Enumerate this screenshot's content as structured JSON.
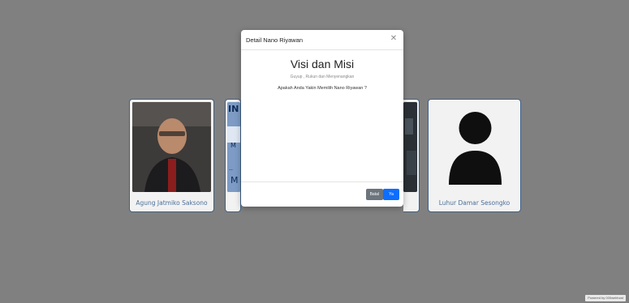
{
  "cards": [
    {
      "name": "Agung Jatmiko Saksono",
      "photo": "portrait-photo"
    },
    {
      "name": "",
      "photo": "poster-photo"
    },
    {
      "name": "",
      "photo": "event-photo"
    },
    {
      "name": "Luhur Damar Sesongko",
      "photo": "default-avatar-silhouette"
    }
  ],
  "modal": {
    "title": "Detail Nano Riyawan",
    "heading": "Visi dan Misi",
    "subtitle": "Guyup , Rukun dan Menyenangkan",
    "question": "Apakah Anda Yakin Memilih Nano Riyawan ?",
    "cancel_label": "Batal",
    "yes_label": "Ya",
    "close_icon": "close-icon"
  },
  "footer": {
    "powered_by": "Powered by 000webhost"
  },
  "colors": {
    "backdrop": "#808080",
    "card_border": "#3e5f86",
    "name_text": "#4b6f99",
    "btn_secondary": "#6c757d",
    "btn_primary": "#0d6efd"
  }
}
